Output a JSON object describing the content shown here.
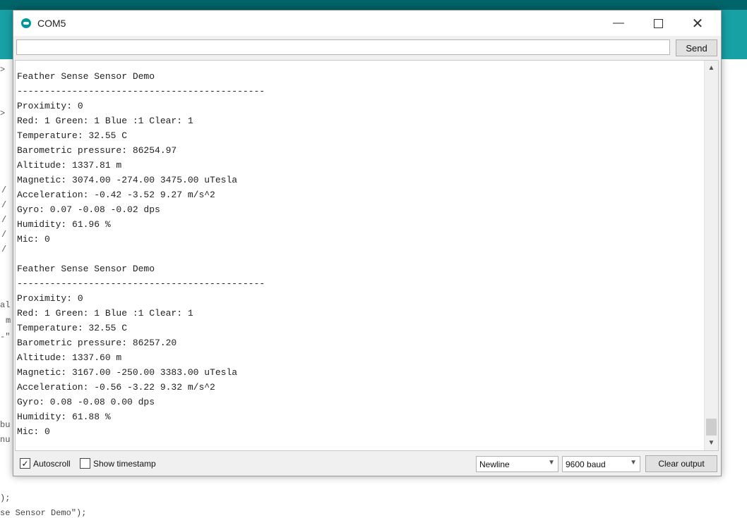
{
  "window": {
    "title": "COM5",
    "minimize": "—",
    "close": "✕"
  },
  "send": {
    "input_value": "",
    "button_label": "Send"
  },
  "output_lines": [
    "Feather Sense Sensor Demo",
    "---------------------------------------------",
    "Proximity: 0",
    "Red: 1 Green: 1 Blue :1 Clear: 1",
    "Temperature: 32.55 C",
    "Barometric pressure: 86254.97",
    "Altitude: 1337.81 m",
    "Magnetic: 3074.00 -274.00 3475.00 uTesla",
    "Acceleration: -0.42 -3.52 9.27 m/s^2",
    "Gyro: 0.07 -0.08 -0.02 dps",
    "Humidity: 61.96 %",
    "Mic: 0",
    "",
    "Feather Sense Sensor Demo",
    "---------------------------------------------",
    "Proximity: 0",
    "Red: 1 Green: 1 Blue :1 Clear: 1",
    "Temperature: 32.55 C",
    "Barometric pressure: 86257.20",
    "Altitude: 1337.60 m",
    "Magnetic: 3167.00 -250.00 3383.00 uTesla",
    "Acceleration: -0.56 -3.22 9.32 m/s^2",
    "Gyro: 0.08 -0.08 0.00 dps",
    "Humidity: 61.88 %",
    "Mic: 0"
  ],
  "footer": {
    "autoscroll_label": "Autoscroll",
    "autoscroll_checked": true,
    "timestamp_label": "Show timestamp",
    "timestamp_checked": false,
    "line_ending": "Newline",
    "baud_rate": "9600 baud",
    "clear_label": "Clear output"
  },
  "background_code": {
    "line1": ");",
    "line2": "se Sensor Demo\");"
  },
  "colors": {
    "ide_header": "#17a1a5",
    "ide_topbar": "#006468"
  }
}
